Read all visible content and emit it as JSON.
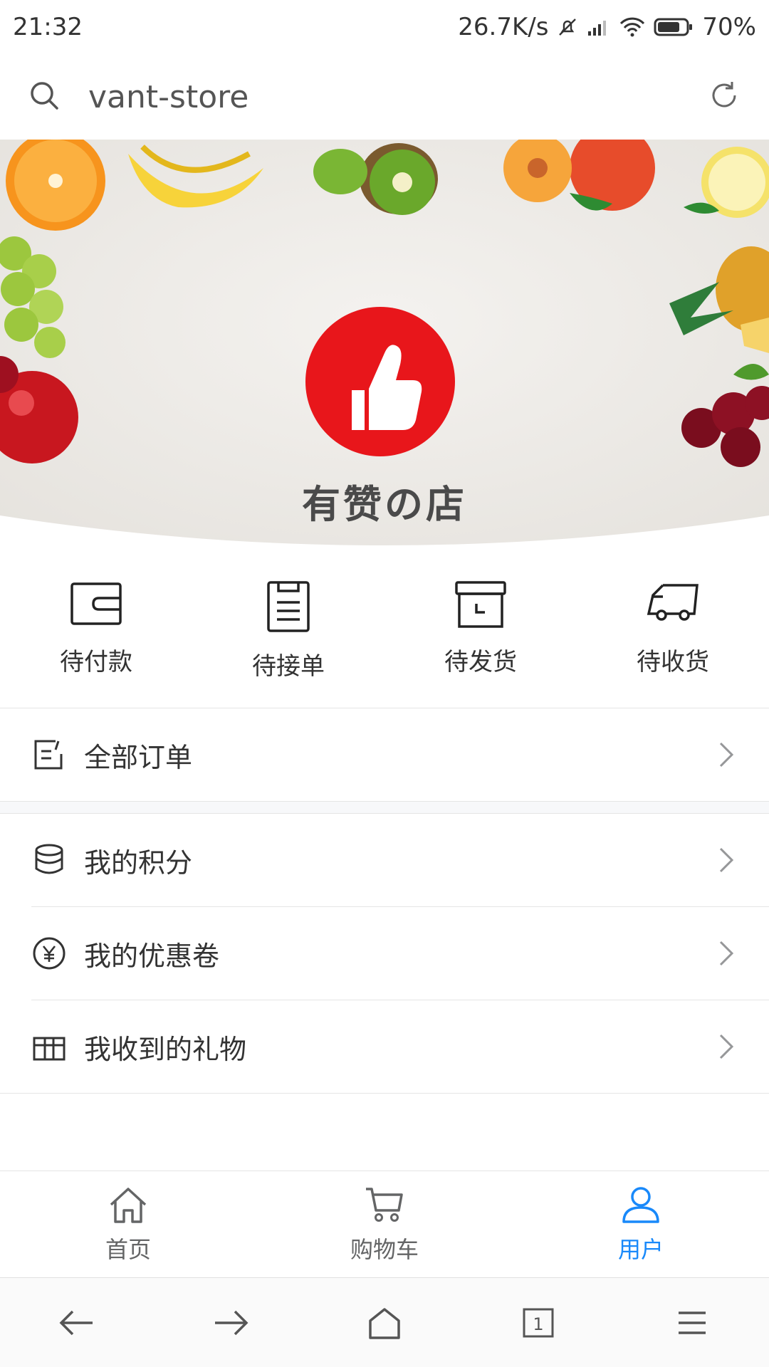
{
  "status_bar": {
    "time": "21:32",
    "network_speed": "26.7K/s",
    "battery": "70%",
    "icons": [
      "bell-muted-icon",
      "signal-icon",
      "wifi-icon",
      "battery-icon"
    ]
  },
  "browser": {
    "address": "vant-store",
    "icons": [
      "search-icon",
      "refresh-icon"
    ]
  },
  "banner": {
    "title": "有赞の店",
    "logo": "thumbs-up-logo",
    "accent_color": "#e8161b"
  },
  "order_status": [
    {
      "label": "待付款",
      "icon": "wallet-icon"
    },
    {
      "label": "待接单",
      "icon": "clipboard-icon"
    },
    {
      "label": "待发货",
      "icon": "box-icon"
    },
    {
      "label": "待收货",
      "icon": "truck-icon"
    }
  ],
  "menu": {
    "all_orders": {
      "label": "全部订单",
      "icon": "order-edit-icon"
    },
    "items": [
      {
        "label": "我的积分",
        "icon": "points-coins-icon"
      },
      {
        "label": "我的优惠卷",
        "icon": "coupon-yen-icon"
      },
      {
        "label": "我收到的礼物",
        "icon": "gift-icon"
      }
    ]
  },
  "tabbar": {
    "tabs": [
      {
        "label": "首页",
        "icon": "home-icon",
        "active": false
      },
      {
        "label": "购物车",
        "icon": "cart-icon",
        "active": false
      },
      {
        "label": "用户",
        "icon": "user-icon",
        "active": true
      }
    ],
    "active_color": "#1989fa"
  },
  "browser_nav": {
    "tabs_count": "1",
    "icons": [
      "back-arrow-icon",
      "forward-arrow-icon",
      "home-outline-icon",
      "tabs-icon",
      "menu-icon"
    ]
  }
}
